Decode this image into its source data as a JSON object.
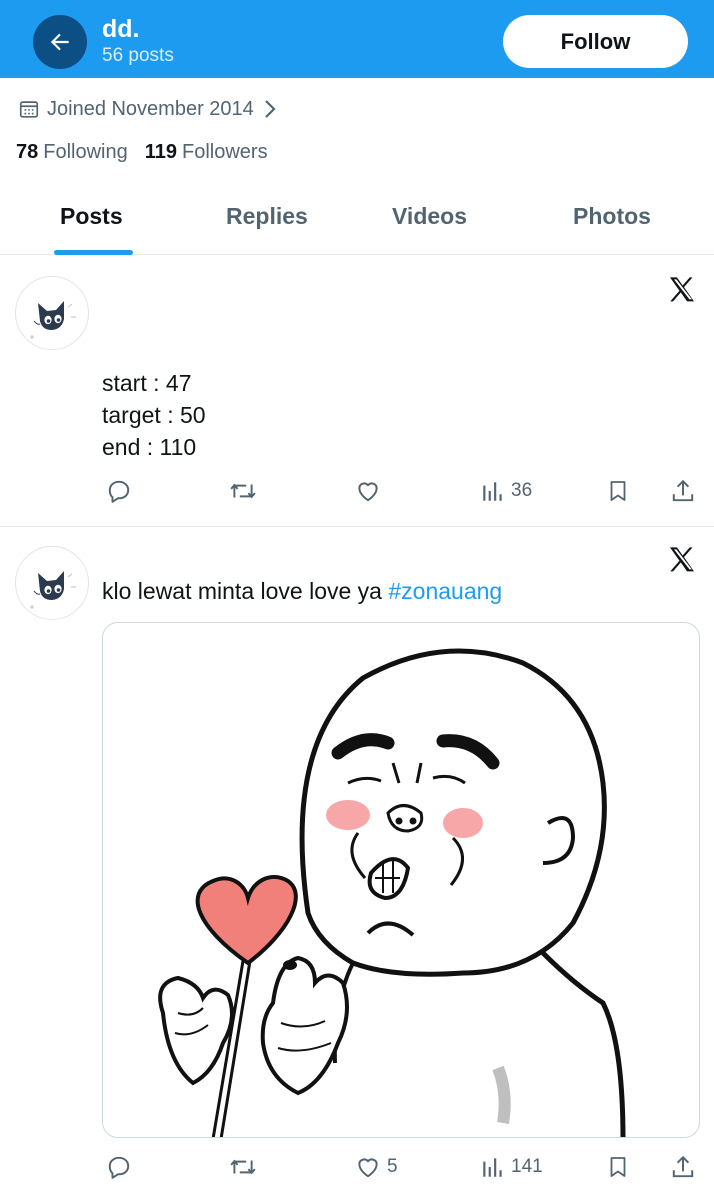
{
  "header": {
    "name": "dd.",
    "post_count": "56 posts",
    "follow_label": "Follow"
  },
  "profile": {
    "joined": "Joined November 2014",
    "following_count": "78",
    "following_label": "Following",
    "followers_count": "119",
    "followers_label": "Followers"
  },
  "tabs": [
    {
      "label": "Posts",
      "active": true
    },
    {
      "label": "Replies",
      "active": false
    },
    {
      "label": "Videos",
      "active": false
    },
    {
      "label": "Photos",
      "active": false
    }
  ],
  "posts": [
    {
      "lines": [
        "start : 47",
        "target : 50",
        "end : 110"
      ],
      "actions": {
        "replies": "",
        "reposts": "",
        "likes": "",
        "views": "36"
      }
    },
    {
      "text": "klo lewat minta love love ya",
      "hashtag": "#zonauang",
      "actions": {
        "replies": "",
        "reposts": "",
        "likes": "5",
        "views": "141"
      }
    }
  ],
  "colors": {
    "accent": "#1d9bf0",
    "header_bg": "#1d9bf0",
    "back_button": "#0c4f84",
    "text_primary": "#0f1419",
    "text_secondary": "#536471",
    "heart_fill": "#f2807a",
    "blush": "#f48a8a"
  },
  "icons": [
    "back-arrow-icon",
    "calendar-icon",
    "chevron-right-icon",
    "x-logo-icon",
    "reply-icon",
    "repost-icon",
    "like-icon",
    "views-icon",
    "bookmark-icon",
    "share-icon"
  ]
}
